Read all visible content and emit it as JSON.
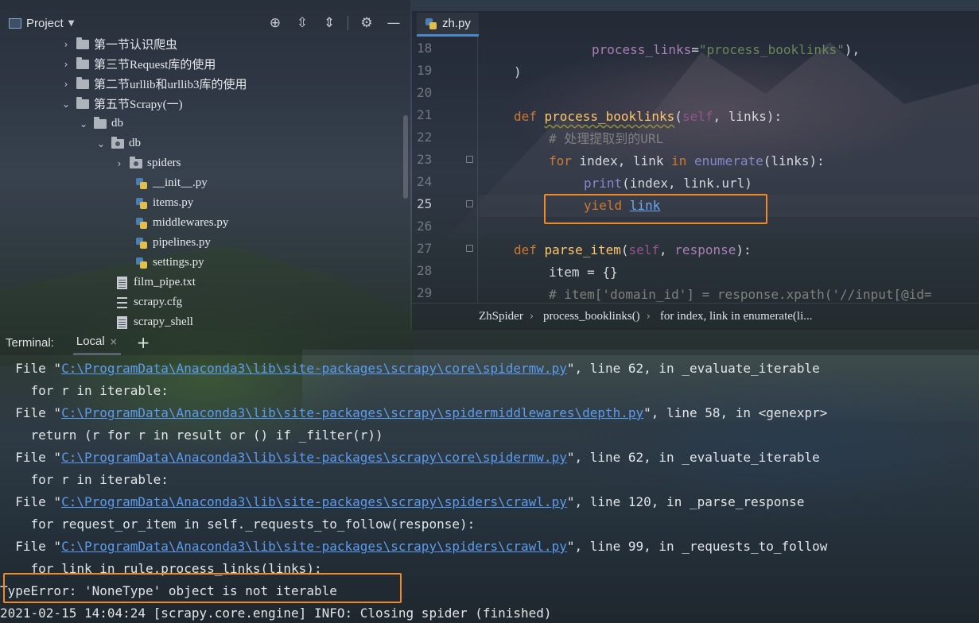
{
  "project": {
    "title": "Project",
    "tools": [
      "target-icon",
      "expand-all-icon",
      "collapse-all-icon",
      "gear-icon",
      "minimize-icon"
    ],
    "tree": [
      {
        "label": "第一节认识爬虫",
        "kind": "folder",
        "expanded": false
      },
      {
        "label": "第三节Request库的使用",
        "kind": "folder",
        "expanded": false
      },
      {
        "label": "第二节urllib和urllib3库的使用",
        "kind": "folder",
        "expanded": false
      },
      {
        "label": "第五节Scrapy(一)",
        "kind": "folder",
        "expanded": true
      },
      {
        "label": "db",
        "kind": "folder",
        "expanded": true
      },
      {
        "label": "db",
        "kind": "package",
        "expanded": true
      },
      {
        "label": "spiders",
        "kind": "package",
        "expanded": false
      },
      {
        "label": "__init__.py",
        "kind": "python"
      },
      {
        "label": "items.py",
        "kind": "python"
      },
      {
        "label": "middlewares.py",
        "kind": "python"
      },
      {
        "label": "pipelines.py",
        "kind": "python"
      },
      {
        "label": "settings.py",
        "kind": "python"
      },
      {
        "label": "film_pipe.txt",
        "kind": "text"
      },
      {
        "label": "scrapy.cfg",
        "kind": "config"
      },
      {
        "label": "scrapy_shell",
        "kind": "text"
      }
    ]
  },
  "editor": {
    "tab_label": "zh.py",
    "line_numbers": [
      "18",
      "19",
      "20",
      "21",
      "22",
      "23",
      "24",
      "25",
      "26",
      "27",
      "28",
      "29"
    ],
    "current_line": "25",
    "code": {
      "l18_a": "process_links",
      "l18_b": "=",
      "l18_c": "\"process_booklinks\"",
      "l18_d": "),",
      "l19": ")",
      "l21_def": "def ",
      "l21_fn": "process_booklinks",
      "l21_open": "(",
      "l21_self": "self",
      "l21_rest": ", links):",
      "l22": "# 处理提取到的URL",
      "l23_for": "for ",
      "l23_mid": "index, link ",
      "l23_in": "in ",
      "l23_enum": "enumerate",
      "l23_rest": "(links):",
      "l24_print": "print",
      "l24_rest": "(index, link.url)",
      "l25_yield": "yield ",
      "l25_link": "link",
      "l27_def": "def ",
      "l27_fn": "parse_item",
      "l27_open": "(",
      "l27_self": "self",
      "l27_sep": ", ",
      "l27_resp": "response",
      "l27_close": "):",
      "l28": "item = {}",
      "l29": "# item['domain_id'] = response.xpath('//input[@id="
    },
    "breadcrumb": [
      "ZhSpider",
      "process_booklinks()",
      "for index, link in enumerate(li..."
    ]
  },
  "terminal": {
    "title": "Terminal:",
    "tab_label": "Local",
    "close_glyph": "×",
    "add_glyph": "+",
    "lines": [
      {
        "pre": "  File \"",
        "path": "C:\\ProgramData\\Anaconda3\\lib\\site-packages\\scrapy\\core\\spidermw.py",
        "post": "\", line 62, in _evaluate_iterable"
      },
      {
        "pre": "    for r in iterable:",
        "path": "",
        "post": ""
      },
      {
        "pre": "  File \"",
        "path": "C:\\ProgramData\\Anaconda3\\lib\\site-packages\\scrapy\\spidermiddlewares\\depth.py",
        "post": "\", line 58, in <genexpr>"
      },
      {
        "pre": "    return (r for r in result or () if _filter(r))",
        "path": "",
        "post": ""
      },
      {
        "pre": "  File \"",
        "path": "C:\\ProgramData\\Anaconda3\\lib\\site-packages\\scrapy\\core\\spidermw.py",
        "post": "\", line 62, in _evaluate_iterable"
      },
      {
        "pre": "    for r in iterable:",
        "path": "",
        "post": ""
      },
      {
        "pre": "  File \"",
        "path": "C:\\ProgramData\\Anaconda3\\lib\\site-packages\\scrapy\\spiders\\crawl.py",
        "post": "\", line 120, in _parse_response"
      },
      {
        "pre": "    for request_or_item in self._requests_to_follow(response):",
        "path": "",
        "post": ""
      },
      {
        "pre": "  File \"",
        "path": "C:\\ProgramData\\Anaconda3\\lib\\site-packages\\scrapy\\spiders\\crawl.py",
        "post": "\", line 99, in _requests_to_follow"
      },
      {
        "pre": "    for link in rule.process_links(links):",
        "path": "",
        "post": ""
      },
      {
        "pre": "TypeError: 'NoneType' object is not iterable",
        "path": "",
        "post": ""
      },
      {
        "pre": "2021-02-15 14:04:24 [scrapy.core.engine] INFO: Closing spider (finished)",
        "path": "",
        "post": ""
      }
    ]
  },
  "colors": {
    "highlight": "#f0892a",
    "keyword": "#cc7832",
    "function": "#ffc66d",
    "string": "#6a8759",
    "link": "#5b9bf0"
  }
}
